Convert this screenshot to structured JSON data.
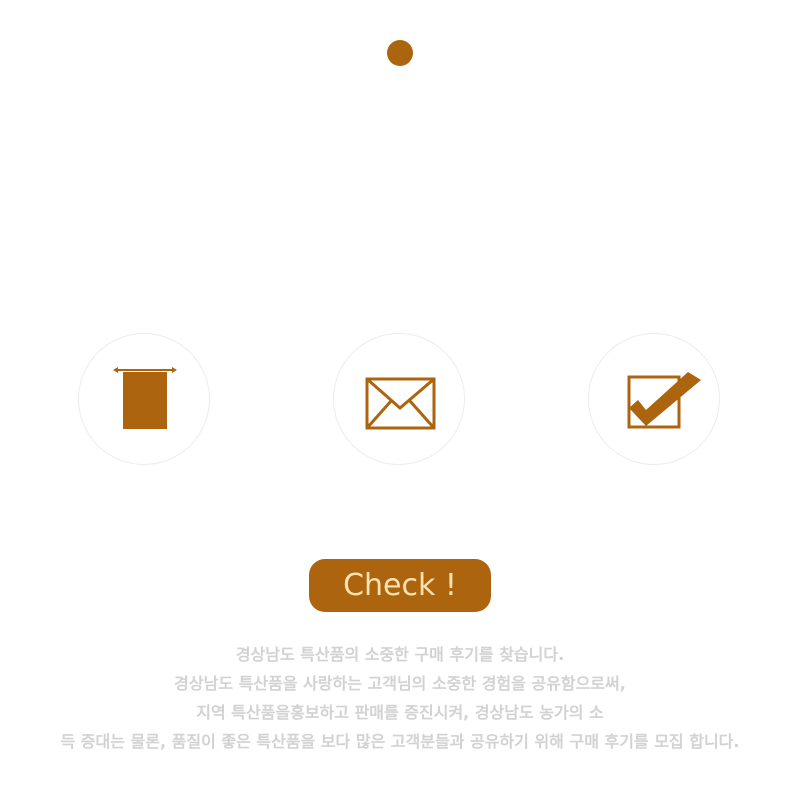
{
  "colors": {
    "accent": "#ac640e",
    "button_text": "#fde2b2",
    "description_text": "#d2d2d2",
    "circle_border": "#ececec"
  },
  "top_dot": {
    "icon": "dot-icon"
  },
  "features": [
    {
      "icon": "banner-icon"
    },
    {
      "icon": "envelope-icon"
    },
    {
      "icon": "checkbox-icon"
    }
  ],
  "cta": {
    "label": "Check !"
  },
  "description": {
    "lines": [
      "경상남도 특산품의 소중한 구매 후기를 찾습니다.",
      "경상남도 특산품을 사랑하는 고객님의 소중한 경험을 공유함으로써,",
      "지역 특산품을홍보하고 판매를 증진시켜, 경상남도 농가의 소",
      "득 증대는 물론, 품질이 좋은 특산품을 보다 많은 고객분들과 공유하기 위해 구매 후기를 모집 합니다."
    ]
  }
}
